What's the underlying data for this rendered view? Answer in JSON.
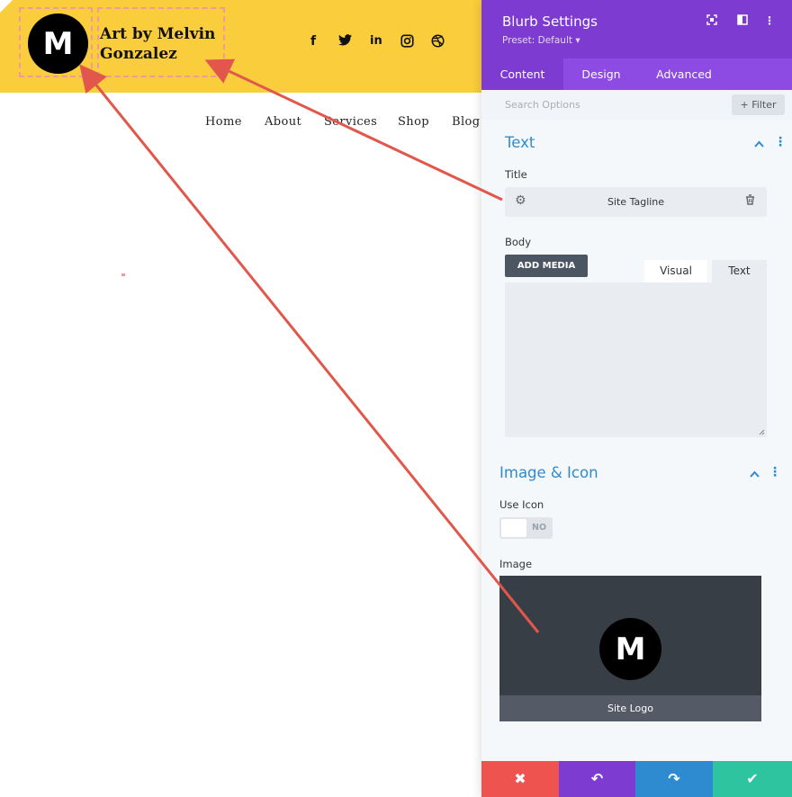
{
  "site": {
    "logo_letter": "M",
    "title": "Art by Melvin Gonzalez",
    "social": [
      "f",
      "t",
      "in",
      "ig",
      "dr"
    ],
    "nav": [
      "Home",
      "About",
      "Services",
      "Shop",
      "Blog"
    ]
  },
  "panel": {
    "title": "Blurb Settings",
    "preset": "Preset: Default ▾",
    "tabs": [
      "Content",
      "Design",
      "Advanced"
    ],
    "search_placeholder": "Search Options",
    "filter_label": "+ Filter",
    "text_section": {
      "title": "Text",
      "title_label": "Title",
      "title_value": "Site Tagline",
      "body_label": "Body",
      "add_media": "ADD MEDIA",
      "editor_tabs": [
        "Visual",
        "Text"
      ]
    },
    "image_section": {
      "title": "Image & Icon",
      "use_icon_label": "Use Icon",
      "use_icon_value": "NO",
      "image_label": "Image",
      "image_logo_letter": "M",
      "image_caption": "Site Logo"
    },
    "footer": {
      "cancel": "✖",
      "undo": "↶",
      "redo": "↷",
      "save": "✔"
    }
  },
  "colors": {
    "header_yellow": "#f9cd3c",
    "panel_purple": "#7d3bd1",
    "accent_blue": "#2e8bd0",
    "annotation_red": "#e2574c",
    "btn_cancel": "#ef5350",
    "btn_undo": "#7d3bd1",
    "btn_redo": "#2e8bd0",
    "btn_save": "#2ec4a0"
  }
}
